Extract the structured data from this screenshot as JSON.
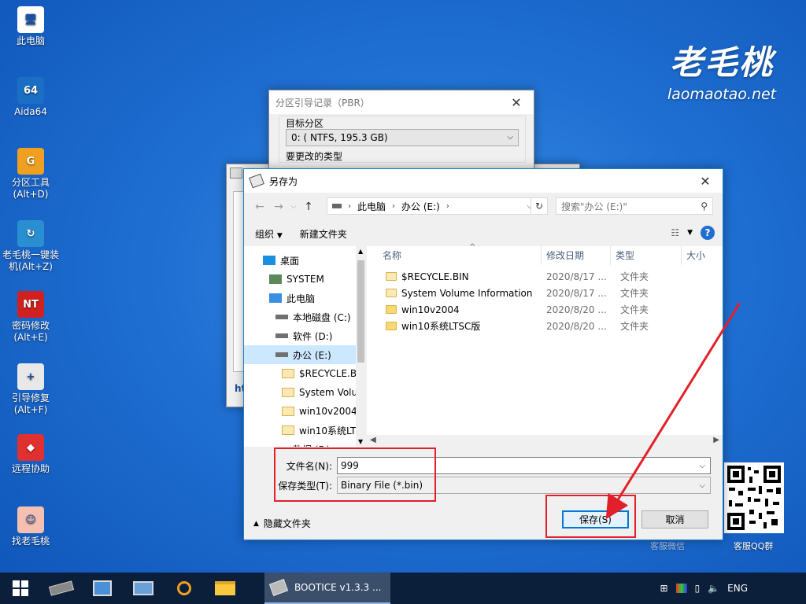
{
  "desktop": {
    "icons": [
      {
        "label": "此电脑",
        "glyph": "🖥",
        "color": "#ffffff"
      },
      {
        "label": "Aida64",
        "glyph": "64",
        "color": "#1a6fc4"
      },
      {
        "label": "分区工具\n(Alt+D)",
        "glyph": "G",
        "color": "#f0a020"
      },
      {
        "label": "老毛桃一键装\n机(Alt+Z)",
        "glyph": "↻",
        "color": "#2a8fd0"
      },
      {
        "label": "密码修改\n(Alt+E)",
        "glyph": "NT",
        "color": "#d02020"
      },
      {
        "label": "引导修复\n(Alt+F)",
        "glyph": "+",
        "color": "#e8e8e8"
      },
      {
        "label": "远程协助",
        "glyph": "◆",
        "color": "#e03030"
      },
      {
        "label": "找老毛桃",
        "glyph": "☺",
        "color": "#f5c0b0"
      }
    ]
  },
  "brand": {
    "cn": "老毛桃",
    "en": "laomaotao.net"
  },
  "qr": {
    "label_left": "客服微信",
    "label_right": "客服QQ群"
  },
  "pbr_dialog": {
    "title": "分区引导记录（PBR）",
    "target_label": "目标分区",
    "target_value": "0: ( NTFS, 195.3 GB)",
    "change_type_label": "要更改的类型"
  },
  "bootice_partial": {
    "text": "ht"
  },
  "save_dialog": {
    "title": "另存为",
    "breadcrumb": [
      "此电脑",
      "办公 (E:)"
    ],
    "search_placeholder": "搜索\"办公 (E:)\"",
    "organize": "组织",
    "new_folder": "新建文件夹",
    "help": "?",
    "tree": [
      {
        "label": "桌面",
        "icon": "desktop"
      },
      {
        "label": "SYSTEM",
        "icon": "user"
      },
      {
        "label": "此电脑",
        "icon": "pc"
      },
      {
        "label": "本地磁盘 (C:)",
        "icon": "drive"
      },
      {
        "label": "软件 (D:)",
        "icon": "drive"
      },
      {
        "label": "办公 (E:)",
        "icon": "drive"
      },
      {
        "label": "$RECYCLE.B",
        "icon": "folder"
      },
      {
        "label": "System Volu",
        "icon": "folder"
      },
      {
        "label": "win10v2004",
        "icon": "folder"
      },
      {
        "label": "win10系统LT",
        "icon": "folder"
      },
      {
        "label": "数据 (F:)",
        "icon": "drive"
      }
    ],
    "columns": [
      "名称",
      "修改日期",
      "类型",
      "大小"
    ],
    "files": [
      {
        "name": "$RECYCLE.BIN",
        "date": "2020/8/17 ...",
        "type": "文件夹",
        "lite": true
      },
      {
        "name": "System Volume Information",
        "date": "2020/8/17 ...",
        "type": "文件夹",
        "lite": true
      },
      {
        "name": "win10v2004",
        "date": "2020/8/20 ...",
        "type": "文件夹",
        "lite": false
      },
      {
        "name": "win10系统LTSC版",
        "date": "2020/8/20 ...",
        "type": "文件夹",
        "lite": false
      }
    ],
    "filename_label": "文件名(N):",
    "filename_value": "999",
    "filetype_label": "保存类型(T):",
    "filetype_value": "Binary File (*.bin)",
    "hide_folders": "隐藏文件夹",
    "save_button": "保存(S)",
    "cancel_button": "取消"
  },
  "taskbar": {
    "active_app": "BOOTICE v1.3.3 ...",
    "lang": "ENG"
  },
  "colors": {
    "accent": "#0078d7",
    "highlight_red": "#e3202a",
    "desktop": "#1f6fd2"
  }
}
